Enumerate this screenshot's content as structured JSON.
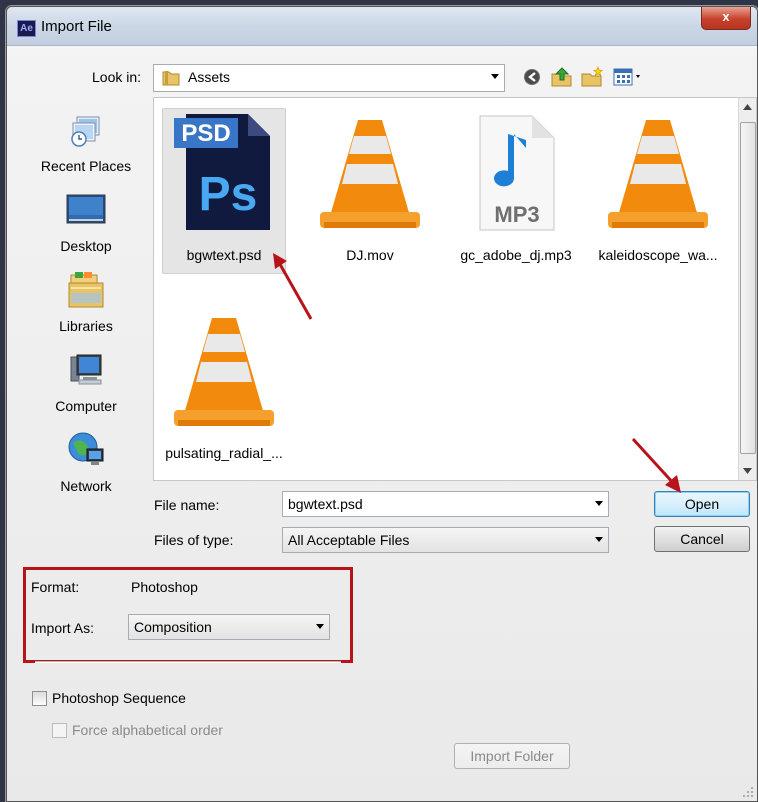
{
  "window": {
    "title": "Import File",
    "app_badge": "Ae",
    "close_glyph": "x"
  },
  "look_in": {
    "label": "Look in:",
    "value": "Assets"
  },
  "toolbar": {
    "icons": [
      "back-icon",
      "up-folder-icon",
      "new-folder-icon",
      "view-menu-icon"
    ]
  },
  "places": [
    {
      "label": "Recent Places",
      "icon": "recent-places-icon"
    },
    {
      "label": "Desktop",
      "icon": "desktop-icon"
    },
    {
      "label": "Libraries",
      "icon": "libraries-icon"
    },
    {
      "label": "Computer",
      "icon": "computer-icon"
    },
    {
      "label": "Network",
      "icon": "network-icon"
    }
  ],
  "files": [
    {
      "name": "bgwtext.psd",
      "icon": "psd-file-icon",
      "selected": true
    },
    {
      "name": "DJ.mov",
      "icon": "vlc-cone-icon"
    },
    {
      "name": "gc_adobe_dj.mp3",
      "icon": "mp3-file-icon"
    },
    {
      "name": "kaleidoscope_wa...",
      "icon": "vlc-cone-icon"
    },
    {
      "name": "pulsating_radial_...",
      "icon": "vlc-cone-icon"
    }
  ],
  "psd_icon": {
    "top": "PSD",
    "main": "Ps"
  },
  "mp3_icon": {
    "label": "MP3"
  },
  "file_name": {
    "label": "File name:",
    "value": "bgwtext.psd"
  },
  "file_type": {
    "label": "Files of type:",
    "value": "All Acceptable Files"
  },
  "buttons": {
    "open": "Open",
    "cancel": "Cancel",
    "import_folder": "Import Folder"
  },
  "format": {
    "label": "Format:",
    "value": "Photoshop"
  },
  "import_as": {
    "label": "Import As:",
    "value": "Composition"
  },
  "options": {
    "sequence": "Photoshop Sequence",
    "force_alpha": "Force alphabetical order"
  },
  "colors": {
    "highlight": "#b8131a",
    "arrow": "#b8131a",
    "vlc_orange": "#f28a0e"
  }
}
